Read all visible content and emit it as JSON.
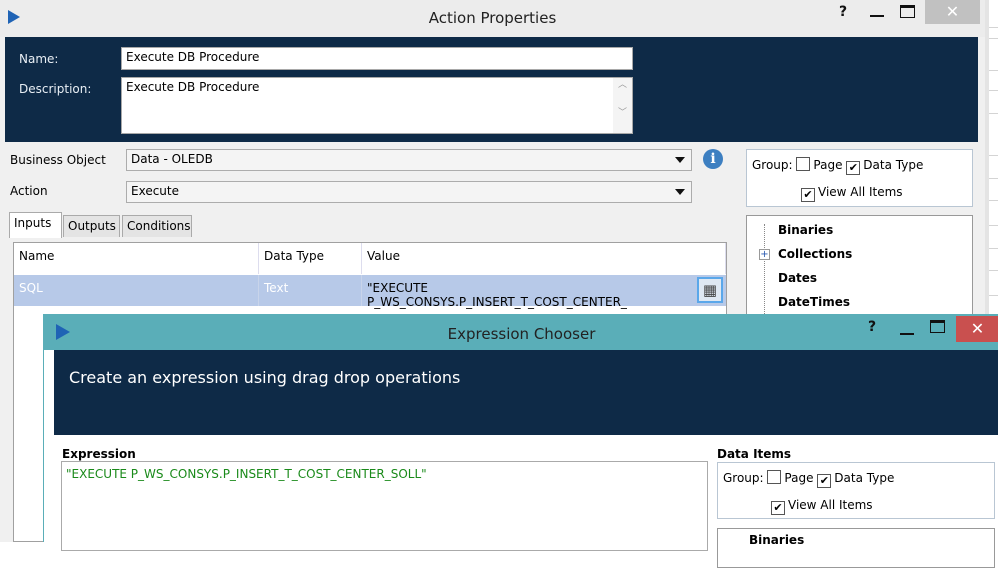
{
  "action_window": {
    "title": "Action Properties",
    "help": "?",
    "name_label": "Name:",
    "name_value": "Execute DB Procedure",
    "description_label": "Description:",
    "description_value": "Execute DB Procedure",
    "business_object_label": "Business Object",
    "business_object_value": "Data - OLEDB",
    "action_label": "Action",
    "action_value": "Execute",
    "tabs": [
      "Inputs",
      "Outputs",
      "Conditions"
    ],
    "table": {
      "headers": [
        "Name",
        "Data Type",
        "Value"
      ],
      "rows": [
        [
          "SQL",
          "Text",
          "\"EXECUTE P_WS_CONSYS.P_INSERT_T_COST_CENTER_"
        ]
      ]
    },
    "group_label": "Group:",
    "page_label": "Page",
    "data_type_label": "Data Type",
    "view_all_label": "View All Items",
    "tree": [
      "Binaries",
      "Collections",
      "Dates",
      "DateTimes"
    ]
  },
  "expression_window": {
    "title": "Expression Chooser",
    "help": "?",
    "header": "Create an expression using drag drop operations",
    "expression_label": "Expression",
    "expression_value": "\"EXECUTE P_WS_CONSYS.P_INSERT_T_COST_CENTER_SOLL\"",
    "data_items_label": "Data Items",
    "group_label": "Group:",
    "page_label": "Page",
    "data_type_label": "Data Type",
    "view_all_label": "View All Items",
    "tree": [
      "Binaries"
    ]
  },
  "colors": {
    "navy": "#0e2a47",
    "teal": "#5aaeb8",
    "close_red": "#c9504f",
    "selection": "#b7c9e8",
    "expr_green": "#1a8a1a"
  }
}
